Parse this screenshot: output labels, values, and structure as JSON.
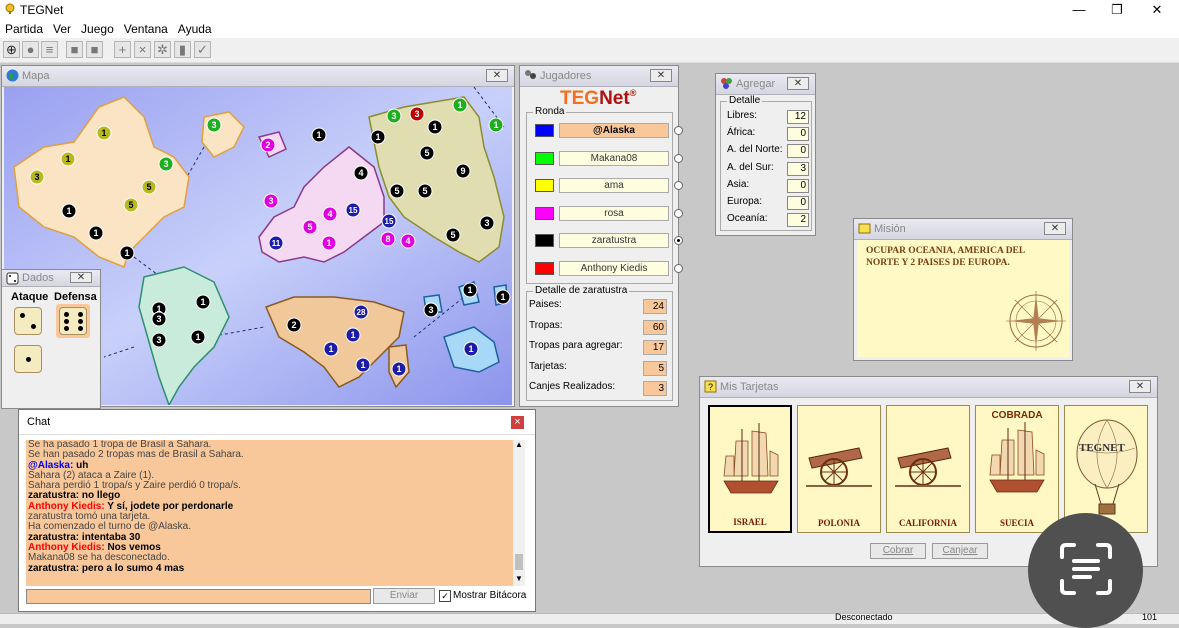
{
  "window": {
    "title": "TEGNet",
    "minimize": "—",
    "maximize": "❐",
    "close": "✕"
  },
  "menu": [
    "Partida",
    "Ver",
    "Juego",
    "Ventana",
    "Ayuda"
  ],
  "map_panel": {
    "title": "Mapa",
    "close": "✕",
    "markers": [
      {
        "n": "1",
        "c": "#b8b820"
      },
      {
        "n": "3",
        "c": "#b8b820"
      },
      {
        "n": "1",
        "c": "#b8b820"
      },
      {
        "n": "3",
        "c": "#1fae1f"
      },
      {
        "n": "5",
        "c": "#b8b820"
      },
      {
        "n": "5",
        "c": "#b8b820"
      },
      {
        "n": "3",
        "c": "#1fae1f"
      },
      {
        "n": "1",
        "c": "#000000"
      },
      {
        "n": "1",
        "c": "#000000"
      },
      {
        "n": "1",
        "c": "#000000"
      },
      {
        "n": "2",
        "c": "#e000e0"
      },
      {
        "n": "3",
        "c": "#e000e0"
      },
      {
        "n": "11",
        "c": "#1c1ca8"
      },
      {
        "n": "5",
        "c": "#e000e0"
      },
      {
        "n": "4",
        "c": "#e000e0"
      },
      {
        "n": "15",
        "c": "#1c1ca8"
      },
      {
        "n": "1",
        "c": "#e000e0"
      },
      {
        "n": "1",
        "c": "#000000"
      },
      {
        "n": "1",
        "c": "#000000"
      },
      {
        "n": "4",
        "c": "#000000"
      },
      {
        "n": "5",
        "c": "#000000"
      },
      {
        "n": "15",
        "c": "#1c1ca8"
      },
      {
        "n": "8",
        "c": "#e000e0"
      },
      {
        "n": "4",
        "c": "#e000e0"
      },
      {
        "n": "3",
        "c": "#1fae1f"
      },
      {
        "n": "3",
        "c": "#c00000"
      },
      {
        "n": "1",
        "c": "#000000"
      },
      {
        "n": "1",
        "c": "#1fae1f"
      },
      {
        "n": "1",
        "c": "#1fae1f"
      },
      {
        "n": "5",
        "c": "#000000"
      },
      {
        "n": "9",
        "c": "#000000"
      },
      {
        "n": "5",
        "c": "#000000"
      },
      {
        "n": "3",
        "c": "#000000"
      },
      {
        "n": "5",
        "c": "#000000"
      },
      {
        "n": "3",
        "c": "#000000"
      },
      {
        "n": "1",
        "c": "#000000"
      },
      {
        "n": "1",
        "c": "#000000"
      },
      {
        "n": "1",
        "c": "#000000"
      },
      {
        "n": "1",
        "c": "#000000"
      },
      {
        "n": "2",
        "c": "#000000"
      },
      {
        "n": "28",
        "c": "#1c1ca8"
      },
      {
        "n": "1",
        "c": "#1c1ca8"
      },
      {
        "n": "1",
        "c": "#1c1ca8"
      },
      {
        "n": "1",
        "c": "#1c1ca8"
      },
      {
        "n": "1",
        "c": "#1c1ca8"
      },
      {
        "n": "3",
        "c": "#000000"
      },
      {
        "n": "3",
        "c": "#000000"
      },
      {
        "n": "1",
        "c": "#000000"
      },
      {
        "n": "1",
        "c": "#1c1ca8"
      }
    ]
  },
  "players_panel": {
    "title": "Jugadores",
    "close": "✕",
    "logo_a": "TEG",
    "logo_b": "Net",
    "logo_mark": "®",
    "ronda_label": "Ronda",
    "players": [
      {
        "name": "@Alaska",
        "color": "#0000ff",
        "bg": "#f9c89a",
        "bold": true,
        "selected": false
      },
      {
        "name": "Makana08",
        "color": "#00ff00",
        "bg": "#fffde0",
        "bold": false,
        "selected": false
      },
      {
        "name": "ama",
        "color": "#ffff00",
        "bg": "#fffde0",
        "bold": false,
        "selected": false
      },
      {
        "name": "rosa",
        "color": "#ff00ff",
        "bg": "#fffde0",
        "bold": false,
        "selected": false
      },
      {
        "name": "zaratustra",
        "color": "#000000",
        "bg": "#fffde0",
        "bold": false,
        "selected": true
      },
      {
        "name": "Anthony Kiedis",
        "color": "#ff0000",
        "bg": "#fffde0",
        "bold": false,
        "selected": false
      }
    ],
    "detail_label": "Detalle de zaratustra",
    "details": [
      {
        "label": "Paises:",
        "value": "24"
      },
      {
        "label": "Tropas:",
        "value": "60"
      },
      {
        "label": "Tropas para agregar:",
        "value": "17"
      },
      {
        "label": "Tarjetas:",
        "value": "5"
      },
      {
        "label": "Canjes Realizados:",
        "value": "3"
      }
    ]
  },
  "agregar_panel": {
    "title": "Agregar",
    "close": "✕",
    "group_label": "Detalle",
    "rows": [
      {
        "label": "Libres:",
        "value": "12"
      },
      {
        "label": "África:",
        "value": "0"
      },
      {
        "label": "A. del Norte:",
        "value": "0"
      },
      {
        "label": "A. del Sur:",
        "value": "3"
      },
      {
        "label": "Asia:",
        "value": "0"
      },
      {
        "label": "Europa:",
        "value": "0"
      },
      {
        "label": "Oceanía:",
        "value": "2"
      }
    ]
  },
  "mision_panel": {
    "title": "Misión",
    "close": "✕",
    "text": "OCUPAR OCEANIA, AMERICA DEL NORTE Y 2 PAISES DE EUROPA."
  },
  "dados_panel": {
    "title": "Dados",
    "close": "✕",
    "ataque": "Ataque",
    "defensa": "Defensa"
  },
  "chat_panel": {
    "title": "Chat",
    "close": "×",
    "lines": [
      {
        "speaker": "",
        "text": "Se ha pasado 1 tropa de Brasil a Sahara.",
        "color": ""
      },
      {
        "speaker": "",
        "text": "Se han pasado 2 tropas mas de Brasil a Sahara.",
        "color": ""
      },
      {
        "speaker": "@Alaska:",
        "text": " uh",
        "color": "#0000ff"
      },
      {
        "speaker": "",
        "text": "Sahara (2) ataca a Zaire (1).",
        "color": ""
      },
      {
        "speaker": "",
        "text": "Sahara perdió 1 tropa/s y Zaire perdió 0 tropa/s.",
        "color": ""
      },
      {
        "speaker": "zaratustra:",
        "text": " no llego",
        "color": "#000000"
      },
      {
        "speaker": "Anthony Kiedis:",
        "text": " Y sí, jodete por perdonarle",
        "color": "#ff0000"
      },
      {
        "speaker": "",
        "text": "zaratustra tomó una tarjeta.",
        "color": ""
      },
      {
        "speaker": "",
        "text": "Ha comenzado el turno de @Alaska.",
        "color": ""
      },
      {
        "speaker": "zaratustra:",
        "text": " intentaba 30",
        "color": "#000000"
      },
      {
        "speaker": "Anthony Kiedis:",
        "text": " Nos vemos",
        "color": "#ff0000"
      },
      {
        "speaker": "",
        "text": "Makana08 se ha desconectado.",
        "color": ""
      },
      {
        "speaker": "zaratustra:",
        "text": " pero a lo sumo 4 mas",
        "color": "#000000"
      }
    ],
    "input_value": "",
    "send_label": "Enviar",
    "show_log_label": "Mostrar Bitácora"
  },
  "tarjetas_panel": {
    "title": "Mis Tarjetas",
    "close": "✕",
    "cards": [
      {
        "name": "ISRAEL",
        "image": "ship",
        "selected": true,
        "cobrada": ""
      },
      {
        "name": "POLONIA",
        "image": "cannon",
        "selected": false,
        "cobrada": ""
      },
      {
        "name": "CALIFORNIA",
        "image": "cannon",
        "selected": false,
        "cobrada": ""
      },
      {
        "name": "SUECIA",
        "image": "ship",
        "selected": false,
        "cobrada": "COBRADA"
      },
      {
        "name": "",
        "image": "balloon",
        "selected": false,
        "cobrada": ""
      }
    ],
    "balloon_text": "TEGNET",
    "cobrar_label": "Cobrar",
    "canjear_label": "Canjear"
  },
  "status_bar": {
    "state": "Desconectado",
    "right": "101"
  }
}
